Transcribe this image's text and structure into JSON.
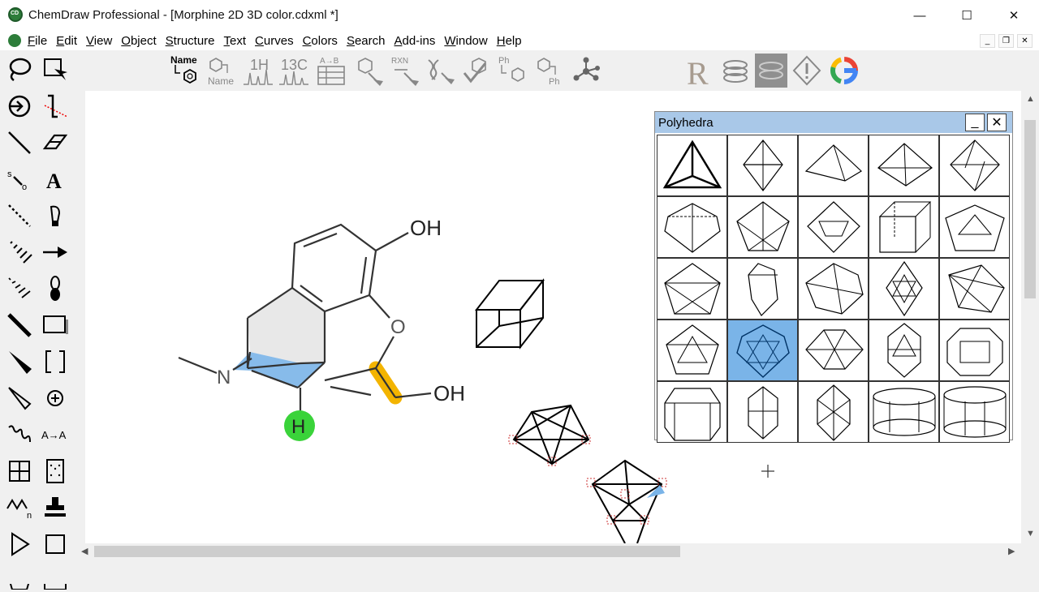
{
  "window": {
    "title": "ChemDraw Professional - [Morphine 2D 3D color.cdxml *]",
    "minimize_glyph": "—",
    "maximize_glyph": "☐",
    "close_glyph": "✕"
  },
  "menu": {
    "items": [
      "File",
      "Edit",
      "View",
      "Object",
      "Structure",
      "Text",
      "Curves",
      "Colors",
      "Search",
      "Add-ins",
      "Window",
      "Help"
    ],
    "mdi_minimize": "_",
    "mdi_restore": "❐",
    "mdi_close": "✕"
  },
  "toolbar": {
    "name_to_structure_label": "Name",
    "structure_to_name_label": "Name",
    "h1_label": "1H",
    "c13_label": "13C",
    "ab_label": "A→B",
    "rxn_label": "RXN",
    "ph_label_top": "Ph",
    "ph_label_bottom": "Ph",
    "r_label": "R",
    "google_label": "G"
  },
  "palette": {
    "text_tool_label": "A",
    "atom_map_label": "A→A",
    "sub_label": "n"
  },
  "molecule": {
    "oh_top": "OH",
    "oh_right": "OH",
    "oxygen": "O",
    "nitrogen": "N",
    "hydrogen": "H"
  },
  "polyhedra_panel": {
    "title": "Polyhedra",
    "minimize_glyph": "_",
    "close_glyph": "✕",
    "selected_index": 16
  },
  "colors": {
    "selection_blue": "#7ab4e8",
    "highlight_yellow": "#f3b400",
    "highlight_green": "#3ad33a",
    "panel_title": "#a9c8e8"
  }
}
